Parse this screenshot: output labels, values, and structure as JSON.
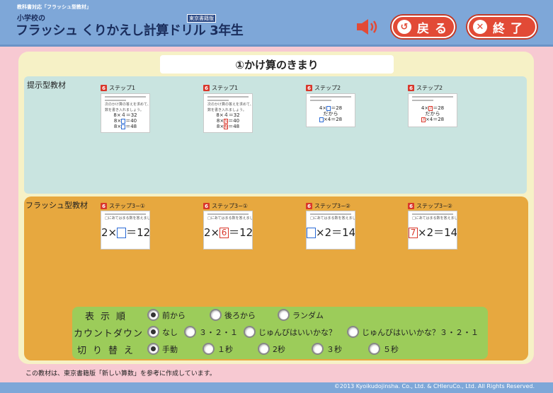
{
  "header": {
    "tag": "教科書対応「フラッシュ型教材」",
    "subtitle": "小学校の",
    "title": "フラッシュ くりかえし計算ドリル",
    "grade": "3年生",
    "badge": "東京書籍版",
    "back_label": "戻る",
    "end_label": "終了",
    "back_icon": "back-arrow-icon",
    "end_icon": "close-icon",
    "speaker_icon": "speaker-icon",
    "accent": "#e24a36"
  },
  "section_title": "①かけ算のきまり",
  "presentation": {
    "label": "提示型教材",
    "cards": [
      {
        "num": "6",
        "step": "ステップ1",
        "inst1": "次のかけ算の答えを求めて、じゅんに",
        "inst2": "数を書き入れましょう。",
        "eq": [
          "8×４＝32",
          "8×□＝40",
          "8×□＝48"
        ]
      },
      {
        "num": "6",
        "step": "ステップ1",
        "inst1": "次のかけ算の答えを求めて、じゅんに",
        "inst2": "数を書き入れましょう。",
        "eq": [
          "8×４＝32",
          "8×5＝40",
          "8×6＝48"
        ]
      },
      {
        "num": "6",
        "step": "ステップ2",
        "eq": [
          "4×□＝28",
          "だから",
          "□×4＝28"
        ]
      },
      {
        "num": "6",
        "step": "ステップ2",
        "eq": [
          "4×7＝28",
          "だから",
          "7×4＝28"
        ]
      }
    ]
  },
  "flash": {
    "label": "フラッシュ型教材",
    "cards": [
      {
        "num": "6",
        "step": "ステップ3−①",
        "inst": "□にあてはまる数を答えましょう。",
        "left": "2×",
        "box": "",
        "right": "＝12"
      },
      {
        "num": "6",
        "step": "ステップ3−①",
        "inst": "□にあてはまる数を答えましょう。",
        "left": "2×",
        "box": "6",
        "right": "＝12"
      },
      {
        "num": "6",
        "step": "ステップ3−②",
        "inst": "□にあてはまる数を答えましょう。",
        "left": "",
        "box": "",
        "right": "×2＝14"
      },
      {
        "num": "6",
        "step": "ステップ3−②",
        "inst": "□にあてはまる数を答えましょう。",
        "left": "",
        "box": "7",
        "right": "×2＝14"
      }
    ]
  },
  "options": {
    "order": {
      "label": "表示順",
      "items": [
        "前から",
        "後ろから",
        "ランダム"
      ],
      "selected": 0
    },
    "countdown": {
      "label": "カウントダウン",
      "items": [
        "なし",
        "３・２・１",
        "じゅんびはいいかな？",
        "じゅんびはいいかな？３・２・１"
      ],
      "selected": 0
    },
    "switch": {
      "label": "切り替え",
      "items": [
        "手動",
        "１秒",
        "2秒",
        "３秒",
        "５秒"
      ],
      "selected": 0
    }
  },
  "footer_note": "この教材は、東京書籍版「新しい算数」を参考に作成しています。",
  "copyright": "©2013 Kyoikudojinsha. Co., Ltd. & CHIeruCo., Ltd. All Rights Reserved."
}
